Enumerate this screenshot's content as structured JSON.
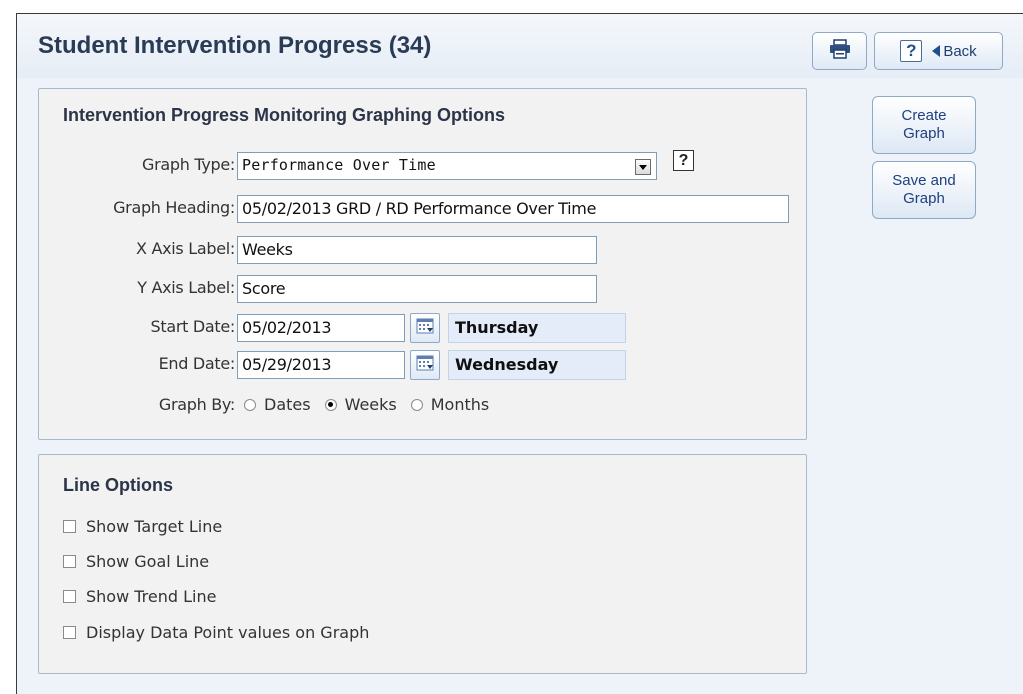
{
  "header": {
    "title": "Student Intervention Progress (34)",
    "print_icon": "printer-icon",
    "help_label": "?",
    "back_label": "Back"
  },
  "graph_options": {
    "title": "Intervention Progress Monitoring Graphing Options",
    "graph_type": {
      "label": "Graph Type:",
      "value": "Performance Over Time",
      "help_label": "?"
    },
    "graph_heading": {
      "label": "Graph Heading:",
      "value": "05/02/2013 GRD / RD Performance Over Time"
    },
    "x_axis_label": {
      "label": "X Axis Label:",
      "value": "Weeks"
    },
    "y_axis_label": {
      "label": "Y Axis Label:",
      "value": "Score"
    },
    "start_date": {
      "label": "Start Date:",
      "value": "05/02/2013",
      "day": "Thursday"
    },
    "end_date": {
      "label": "End Date:",
      "value": "05/29/2013",
      "day": "Wednesday"
    },
    "graph_by": {
      "label": "Graph By:",
      "options": [
        "Dates",
        "Weeks",
        "Months"
      ],
      "selected": "Weeks"
    }
  },
  "line_options": {
    "title": "Line Options",
    "items": [
      {
        "label": "Show Target Line",
        "checked": false
      },
      {
        "label": "Show Goal Line",
        "checked": false
      },
      {
        "label": "Show Trend Line",
        "checked": false
      },
      {
        "label": "Display Data Point values on Graph",
        "checked": false
      }
    ]
  },
  "actions": {
    "create_graph": [
      "Create",
      "Graph"
    ],
    "save_and_graph": [
      "Save and",
      "Graph"
    ]
  },
  "colors": {
    "title": "#2a3b55",
    "panel_background": "#f2f2f2",
    "page_background": "#eef3f9",
    "day_box": "#e3ecf8",
    "button_text": "#1f3f7f"
  }
}
